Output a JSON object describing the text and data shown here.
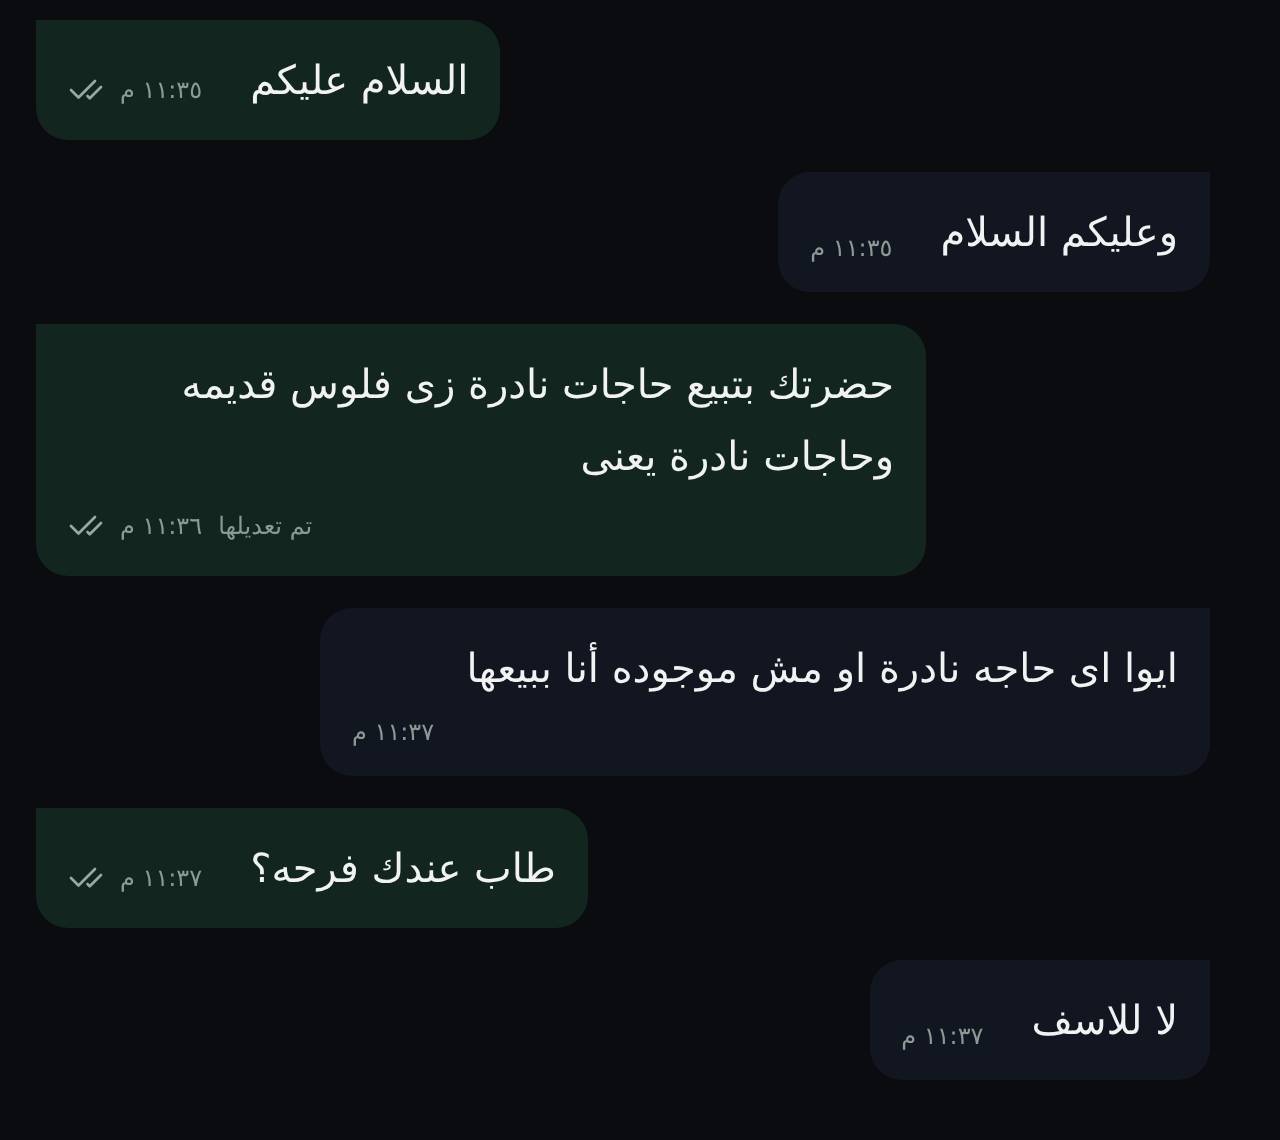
{
  "messages": [
    {
      "kind": "outgoing",
      "text": "السلام عليكم",
      "time": "١١:٣٥ م",
      "delivered": true
    },
    {
      "kind": "incoming",
      "text": "وعليكم السلام",
      "time": "١١:٣٥ م"
    },
    {
      "kind": "outgoing",
      "text": "حضرتك بتبيع حاجات نادرة زى فلوس قديمه\nوحاجات نادرة يعنى",
      "edited_label": "تم تعديلها",
      "time": "١١:٣٦ م",
      "delivered": true
    },
    {
      "kind": "incoming",
      "text": "ايوا اى حاجه نادرة او مش موجوده أنا ببيعها",
      "time": "١١:٣٧ م"
    },
    {
      "kind": "outgoing",
      "text": "طاب عندك فرحه؟",
      "time": "١١:٣٧ م",
      "delivered": true
    },
    {
      "kind": "incoming",
      "text": "لا للاسف",
      "time": "١١:٣٧ م"
    }
  ]
}
